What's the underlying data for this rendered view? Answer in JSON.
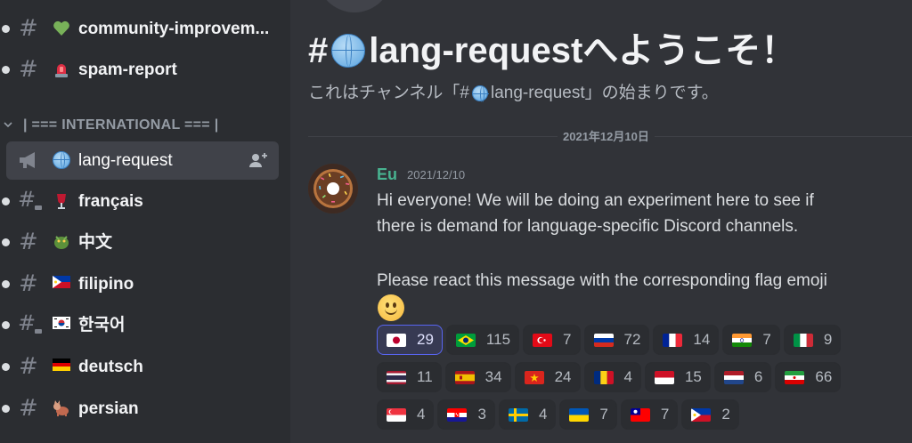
{
  "sidebar": {
    "channels_top": [
      {
        "label": "community-improvem...",
        "emoji": "green-heart-icon",
        "type": "text",
        "unread": true
      },
      {
        "label": "spam-report",
        "emoji": "siren-icon",
        "type": "text",
        "unread": true
      }
    ],
    "category": "| === INTERNATIONAL === |",
    "channels": [
      {
        "label": "lang-request",
        "emoji": "globe-icon",
        "type": "announcement",
        "active": true
      },
      {
        "label": "français",
        "emoji": "wine-glass-icon",
        "type": "thread",
        "unread": true
      },
      {
        "label": "中文",
        "emoji": "dragon-icon",
        "type": "text",
        "unread": true
      },
      {
        "label": "filipino",
        "emoji": "flag-ph-icon",
        "type": "text",
        "unread": true
      },
      {
        "label": "한국어",
        "emoji": "flag-kr-icon",
        "type": "thread",
        "unread": true
      },
      {
        "label": "deutsch",
        "emoji": "flag-de-icon",
        "type": "text",
        "unread": true
      },
      {
        "label": "persian",
        "emoji": "cat-icon",
        "type": "text",
        "unread": true
      }
    ]
  },
  "main": {
    "welcome_prefix": "#",
    "welcome_channel": "lang-request",
    "welcome_suffix": "へようこそ！",
    "subtitle_prefix": "これはチャンネル「#",
    "subtitle_channel": " lang-request",
    "subtitle_suffix": "」の始まりです。",
    "date_divider": "2021年12月10日",
    "message": {
      "author": "Eu",
      "timestamp": "2021/12/10",
      "lines": [
        "Hi everyone! We will be doing an experiment here to see if",
        "there is demand for language-specific Discord channels.",
        "Please react this message with the corresponding flag emoji"
      ],
      "trailing_emoji": "slightly-smiling-face-icon",
      "reactions": [
        [
          {
            "flag": "jp",
            "count": "29",
            "me": true
          },
          {
            "flag": "br",
            "count": "115"
          },
          {
            "flag": "tr",
            "count": "7"
          },
          {
            "flag": "ru",
            "count": "72"
          },
          {
            "flag": "fr",
            "count": "14"
          },
          {
            "flag": "in",
            "count": "7"
          },
          {
            "flag": "it",
            "count": "9"
          }
        ],
        [
          {
            "flag": "th",
            "count": "11"
          },
          {
            "flag": "es",
            "count": "34"
          },
          {
            "flag": "vn",
            "count": "24"
          },
          {
            "flag": "ro",
            "count": "4"
          },
          {
            "flag": "id",
            "count": "15"
          },
          {
            "flag": "nl",
            "count": "6"
          },
          {
            "flag": "ir",
            "count": "66"
          }
        ],
        [
          {
            "flag": "sg",
            "count": "4"
          },
          {
            "flag": "hr",
            "count": "3"
          },
          {
            "flag": "se",
            "count": "4"
          },
          {
            "flag": "ua",
            "count": "7"
          },
          {
            "flag": "tw",
            "count": "7"
          },
          {
            "flag": "ph",
            "count": "2"
          }
        ]
      ]
    }
  },
  "colors": {
    "sidebar_bg": "#2b2d31",
    "main_bg": "#313338",
    "author": "#48b390",
    "accent": "#5865f2"
  }
}
